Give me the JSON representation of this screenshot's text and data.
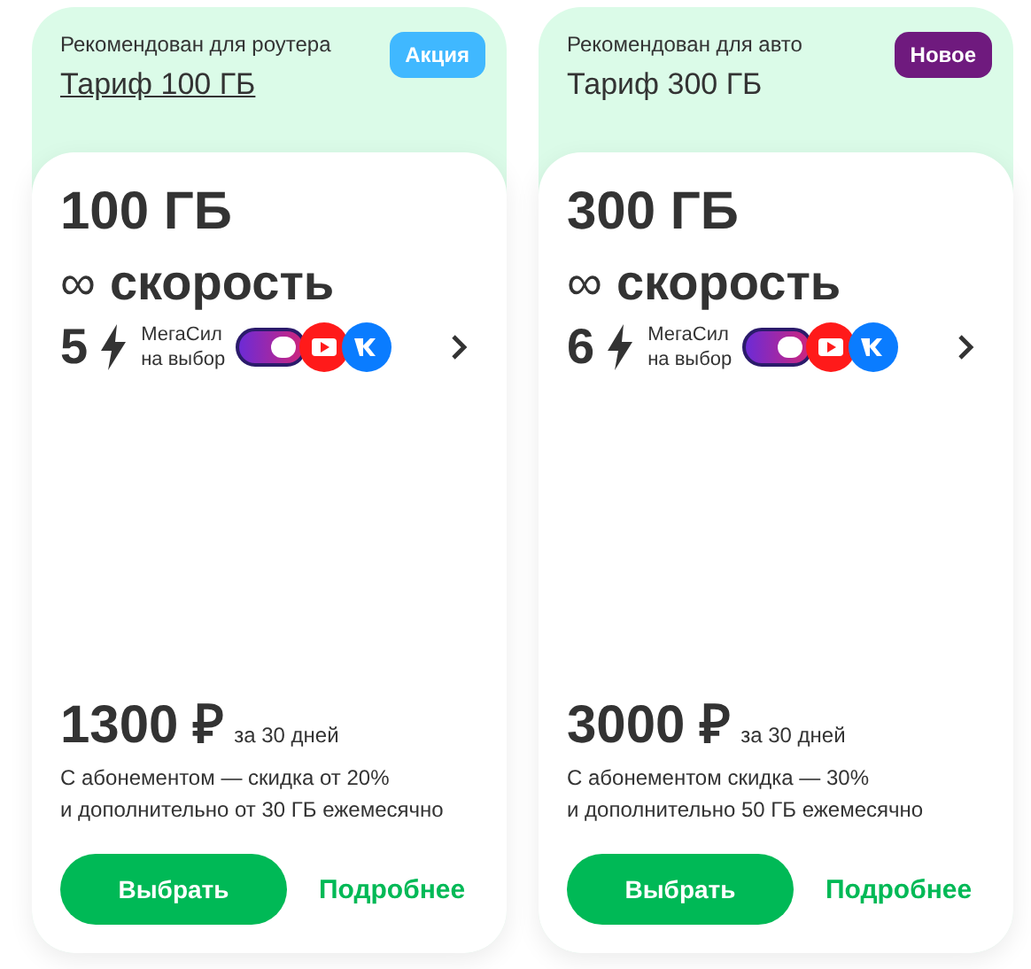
{
  "tariffs": [
    {
      "recommendation": "Рекомендован для роутера",
      "title": "Тариф 100 ГБ",
      "title_underlined": true,
      "badge": {
        "label": "Акция",
        "color": "#40b8ff"
      },
      "volume": "100 ГБ",
      "speed_symbol": "∞",
      "speed": "скорость",
      "megasil_count": "5",
      "megasil_label": "МегаСил",
      "megasil_sub": "на выбор",
      "price": "1300 ₽",
      "period": "за 30 дней",
      "note_1": "С абонементом — скидка от 20%",
      "note_2": "и дополнительно от 30 ГБ ежемесячно",
      "choose": "Выбрать",
      "more": "Подробнее"
    },
    {
      "recommendation": "Рекомендован для авто",
      "title": "Тариф 300 ГБ",
      "title_underlined": false,
      "badge": {
        "label": "Новое",
        "color": "#6f1a7e"
      },
      "volume": "300 ГБ",
      "speed_symbol": "∞",
      "speed": "скорость",
      "megasil_count": "6",
      "megasil_label": "МегаСил",
      "megasil_sub": "на выбор",
      "price": "3000 ₽",
      "period": "за 30 дней",
      "note_1": "С абонементом скидка — 30%",
      "note_2": "и дополнительно 50 ГБ ежемесячно",
      "choose": "Выбрать",
      "more": "Подробнее"
    }
  ]
}
